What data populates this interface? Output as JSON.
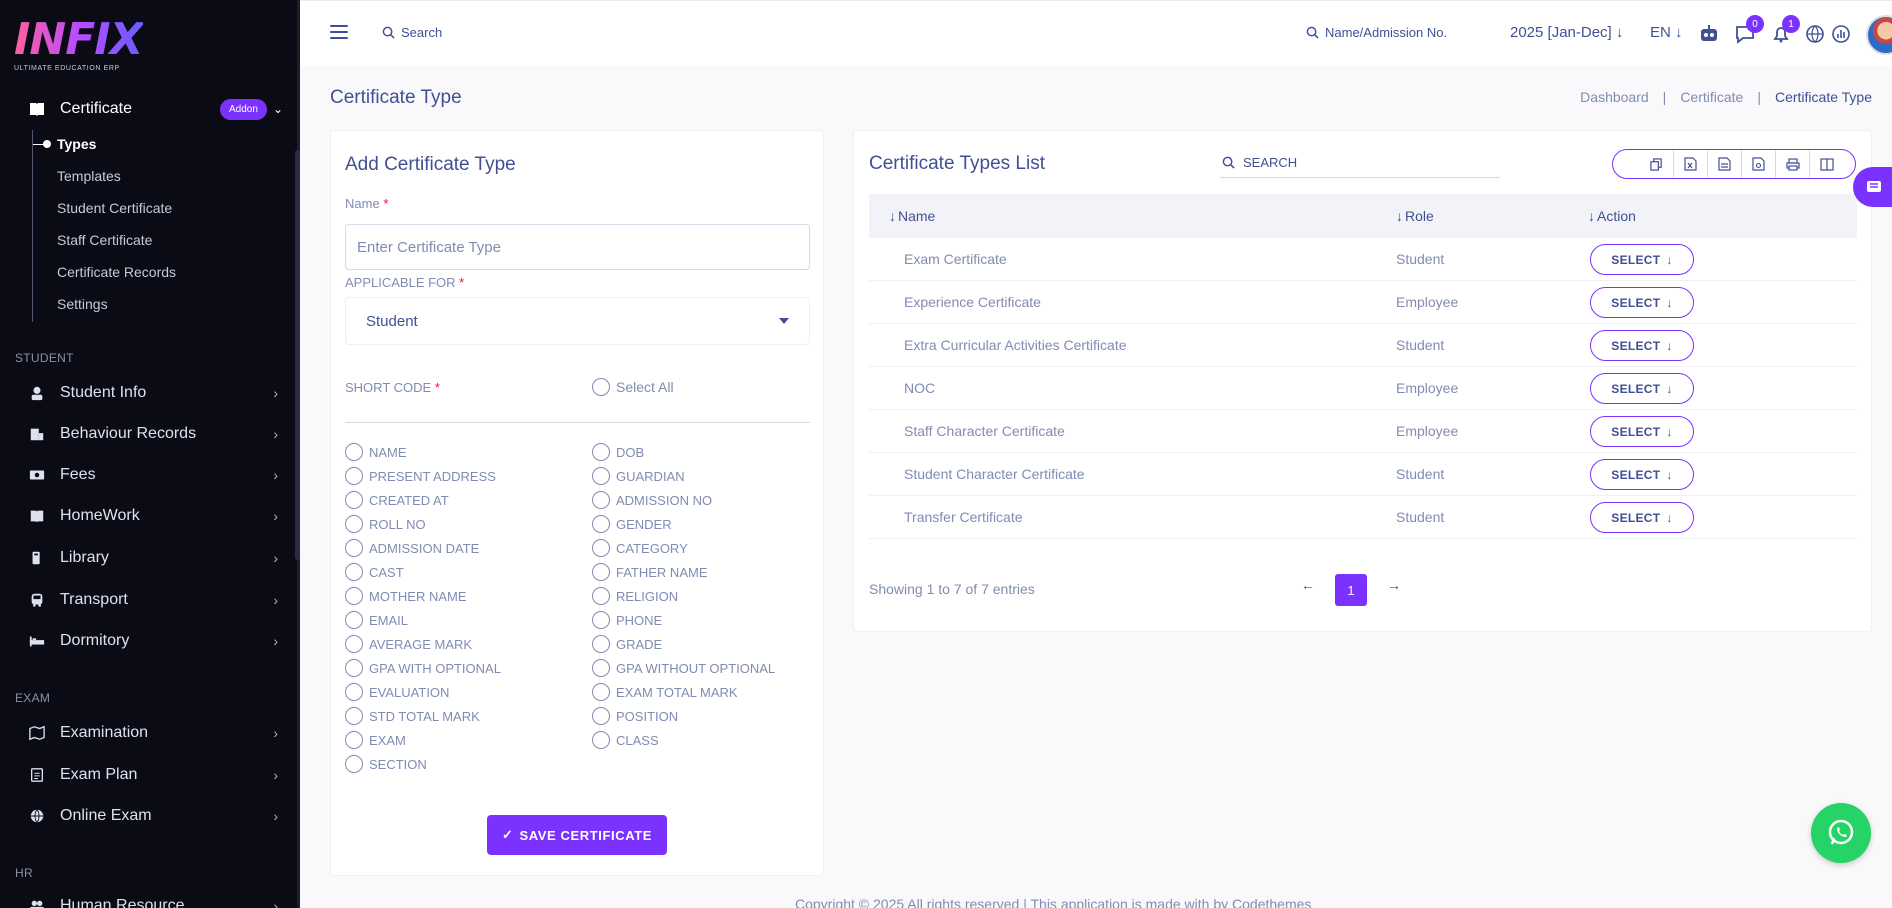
{
  "brand": {
    "name": "INFIX",
    "tagline": "ULTIMATE EDUCATION ERP"
  },
  "sidebar": {
    "certificate": {
      "label": "Certificate",
      "badge": "Addon"
    },
    "sub_items": [
      "Types",
      "Templates",
      "Student Certificate",
      "Staff Certificate",
      "Certificate Records",
      "Settings"
    ],
    "sections": [
      {
        "title": "STUDENT",
        "items": [
          "Student Info",
          "Behaviour Records",
          "Fees",
          "HomeWork",
          "Library",
          "Transport",
          "Dormitory"
        ]
      },
      {
        "title": "EXAM",
        "items": [
          "Examination",
          "Exam Plan",
          "Online Exam"
        ]
      },
      {
        "title": "HR",
        "items": [
          "Human Resource"
        ]
      }
    ]
  },
  "topbar": {
    "search_label": "Search",
    "name_search_label": "Name/Admission No.",
    "year": "2025 [Jan-Dec]",
    "language": "EN",
    "chat_count": "0",
    "notification_count": "1"
  },
  "page": {
    "title": "Certificate Type",
    "breadcrumb": [
      "Dashboard",
      "Certificate",
      "Certificate Type"
    ]
  },
  "form": {
    "title": "Add Certificate Type",
    "name_label": "Name",
    "name_placeholder": "Enter Certificate Type",
    "applicable_label": "APPLICABLE FOR",
    "applicable_value": "Student",
    "short_code_label": "SHORT CODE",
    "select_all_label": "Select All",
    "codes_left": [
      "NAME",
      "PRESENT ADDRESS",
      "CREATED AT",
      "ROLL NO",
      "ADMISSION DATE",
      "CAST",
      "MOTHER NAME",
      "EMAIL",
      "AVERAGE MARK",
      "GPA WITH OPTIONAL",
      "EVALUATION",
      "STD TOTAL MARK",
      "EXAM",
      "SECTION"
    ],
    "codes_right": [
      "DOB",
      "GUARDIAN",
      "ADMISSION NO",
      "GENDER",
      "CATEGORY",
      "FATHER NAME",
      "RELIGION",
      "PHONE",
      "GRADE",
      "GPA WITHOUT OPTIONAL",
      "EXAM TOTAL MARK",
      "POSITION",
      "CLASS"
    ],
    "save_label": "SAVE CERTIFICATE"
  },
  "list": {
    "title": "Certificate Types List",
    "search_placeholder": "SEARCH",
    "columns": [
      "Name",
      "Role",
      "Action"
    ],
    "rows": [
      {
        "name": "Exam Certificate",
        "role": "Student",
        "action": "SELECT"
      },
      {
        "name": "Experience Certificate",
        "role": "Employee",
        "action": "SELECT"
      },
      {
        "name": "Extra Curricular Activities Certificate",
        "role": "Student",
        "action": "SELECT"
      },
      {
        "name": "NOC",
        "role": "Employee",
        "action": "SELECT"
      },
      {
        "name": "Staff Character Certificate",
        "role": "Employee",
        "action": "SELECT"
      },
      {
        "name": "Student Character Certificate",
        "role": "Student",
        "action": "SELECT"
      },
      {
        "name": "Transfer Certificate",
        "role": "Student",
        "action": "SELECT"
      }
    ],
    "showing": "Showing 1 to 7 of 7 entries",
    "current_page": "1"
  },
  "footer": "Copyright © 2025 All rights reserved | This application is made with by Codethemes",
  "colors": {
    "accent": "#7c32ff",
    "text": "#415094",
    "muted": "#828bb2",
    "sidebar": "#0b0b16",
    "whatsapp": "#25d366"
  }
}
